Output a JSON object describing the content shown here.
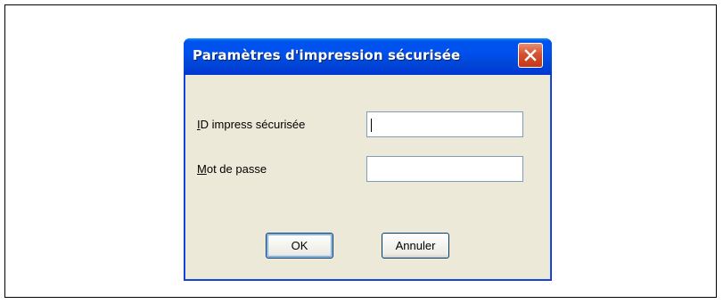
{
  "dialog": {
    "title": "Paramètres d'impression sécurisée",
    "close_icon": "close-icon",
    "colors": {
      "titlebar": "#0053ee",
      "body": "#ece9d8",
      "close_button": "#d7512f",
      "frame_border": "#0831d9"
    }
  },
  "form": {
    "secure_id": {
      "label_mnemonic": "I",
      "label_rest": "D impress sécurisée",
      "value": ""
    },
    "password": {
      "label_mnemonic": "M",
      "label_rest": "ot de passe",
      "value": ""
    }
  },
  "buttons": {
    "ok_label": "OK",
    "cancel_label": "Annuler"
  }
}
